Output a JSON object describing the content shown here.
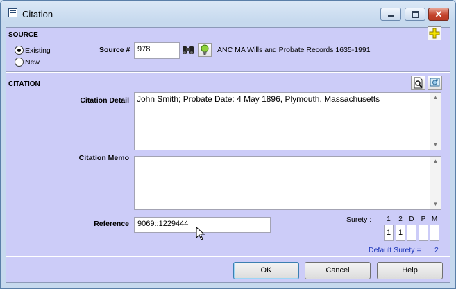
{
  "window": {
    "title": "Citation",
    "controls": [
      "minimize-icon",
      "maximize-icon",
      "close-icon"
    ]
  },
  "source": {
    "section_label": "SOURCE",
    "options": [
      {
        "label": "Existing",
        "checked": true
      },
      {
        "label": "New",
        "checked": false
      }
    ],
    "number_label": "Source #",
    "number_value": "978",
    "title": "ANC MA Wills and Probate Records 1635-1991",
    "icons": [
      "binoculars-icon",
      "lightbulb-icon",
      "add-plus-icon"
    ]
  },
  "citation": {
    "section_label": "CITATION",
    "detail_label": "Citation Detail",
    "detail_value": "John Smith; Probate Date: 4 May 1896, Plymouth, Massachusetts",
    "memo_label": "Citation Memo",
    "memo_value": "",
    "reference_label": "Reference",
    "reference_value": "9069::1229444",
    "icons": [
      "preview-page-icon",
      "camera-media-icon"
    ]
  },
  "surety": {
    "label": "Surety :",
    "columns": [
      "1",
      "2",
      "D",
      "P",
      "M"
    ],
    "values": [
      "1",
      "1",
      "",
      "",
      ""
    ],
    "default_label": "Default Surety =",
    "default_value": "2"
  },
  "buttons": {
    "ok": "OK",
    "cancel": "Cancel",
    "help": "Help"
  },
  "colors": {
    "client_bg": "#ccccf8",
    "default_surety_text": "#1a34b8"
  }
}
